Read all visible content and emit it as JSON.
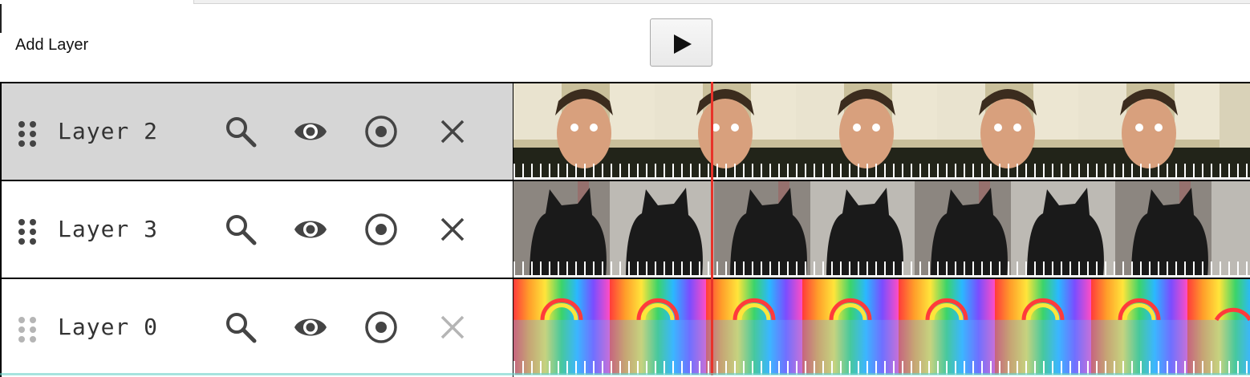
{
  "toolbar": {
    "add_layer_label": "Add Layer",
    "play_icon": "play-icon"
  },
  "layers": [
    {
      "name": "Layer 2",
      "selected": true,
      "delete_enabled": true,
      "thumbnail": "man-staring-frames"
    },
    {
      "name": "Layer 3",
      "selected": false,
      "delete_enabled": true,
      "thumbnail": "black-cat-frames"
    },
    {
      "name": "Layer 0",
      "selected": false,
      "delete_enabled": false,
      "thumbnail": "rainbow-frames"
    }
  ],
  "icons": {
    "drag": "drag-handle-icon",
    "search": "search-icon",
    "visibility": "eye-icon",
    "solo": "target-icon",
    "delete": "close-icon"
  },
  "colors": {
    "selected_row": "#d6d6d6",
    "playhead": "#e8332a",
    "icon": "#444444",
    "icon_disabled": "#b5b5b5"
  }
}
